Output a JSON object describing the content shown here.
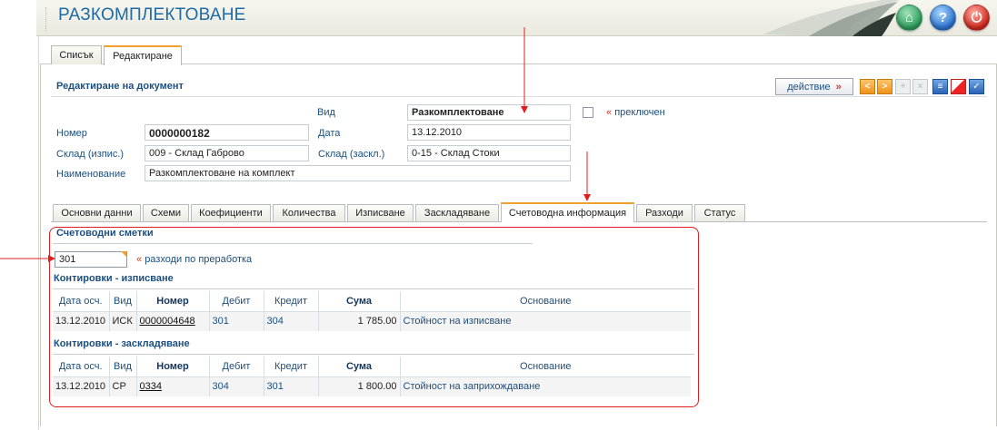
{
  "app": {
    "title": "РАЗКОМПЛЕКТОВАНЕ"
  },
  "tabs": [
    {
      "label": "Списък"
    },
    {
      "label": "Редактиране"
    }
  ],
  "document": {
    "title": "Редактиране на документ",
    "action_label": "действие",
    "fields": {
      "vid_label": "Вид",
      "vid_value": "Разкомплектоване",
      "toggle_label": "преключен",
      "nomer_label": "Номер",
      "nomer_value": "0000000182",
      "data_label": "Дата",
      "data_value": "13.12.2010",
      "sklad_out_label": "Склад (изпис.)",
      "sklad_out_value": "009 - Склад Габрово",
      "sklad_in_label": "Склад (заскл.)",
      "sklad_in_value": "0-15 - Склад Стоки",
      "name_label": "Наименование",
      "name_value": "Разкомплектоване на комплект"
    }
  },
  "subtabs": [
    {
      "label": "Основни данни"
    },
    {
      "label": "Схеми"
    },
    {
      "label": "Коефициенти"
    },
    {
      "label": "Количества"
    },
    {
      "label": "Изписване"
    },
    {
      "label": "Заскладяване"
    },
    {
      "label": "Счетоводна информация"
    },
    {
      "label": "Разходи"
    },
    {
      "label": "Статус"
    }
  ],
  "accounting": {
    "accounts_title": "Счетоводни сметки",
    "account_value": "301",
    "account_desc": "разходи по преработка",
    "columns": {
      "date": "Дата осч.",
      "type": "Вид",
      "number": "Номер",
      "debit": "Дебит",
      "credit": "Кредит",
      "sum": "Сума",
      "reason": "Основание"
    },
    "writeoff_title": "Контировки - изписване",
    "writeoff_row": {
      "date": "13.12.2010",
      "type": "ИСК",
      "number": "0000004648",
      "debit": "301",
      "credit": "304",
      "sum": "1 785.00",
      "reason": "Стойност на изписване"
    },
    "stock_title": "Контировки - заскладяване",
    "stock_row": {
      "date": "13.12.2010",
      "type": "СР",
      "number": "0334",
      "debit": "304",
      "credit": "301",
      "sum": "1 800.00",
      "reason": "Стойност на заприхождаване"
    }
  },
  "colors": {
    "accent": "#1b4f7f",
    "annotation": "#e02020",
    "tab_highlight": "#f0a030"
  }
}
